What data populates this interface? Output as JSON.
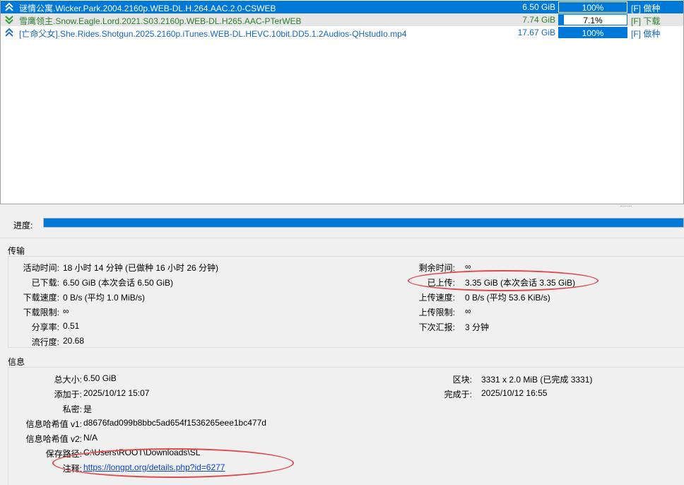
{
  "torrents": [
    {
      "name": "谜情公寓.Wicker.Park.2004.2160p.WEB-DL.H.264.AAC.2.0-CSWEB",
      "size": "6.50 GiB",
      "progress": "100%",
      "progress_value": 1.0,
      "status": "[F] 做种",
      "icon": "seed-up-icon"
    },
    {
      "name": "雪鹰领主.Snow.Eagle.Lord.2021.S03.2160p.WEB-DL.H265.AAC-PTerWEB",
      "size": "7.74 GiB",
      "progress": "7.1%",
      "progress_value": 0.071,
      "status": "[F] 下载",
      "icon": "download-down-icon"
    },
    {
      "name": "[亡命父女].She.Rides.Shotgun.2025.2160p.iTunes.WEB-DL.HEVC.10bit.DD5.1.2Audios-QHstudIo.mp4",
      "size": "17.67 GiB",
      "progress": "100%",
      "progress_value": 1.0,
      "status": "[F] 做种",
      "icon": "seed-up-icon"
    }
  ],
  "progress": {
    "label": "进度:",
    "value": 1.0
  },
  "transfer": {
    "title": "传输",
    "active_time_label": "活动时间:",
    "active_time": "18 小时 14 分钟 (已做种 16 小时 26 分钟)",
    "downloaded_label": "已下载:",
    "downloaded": "6.50 GiB (本次会话 6.50 GiB)",
    "dl_speed_label": "下载速度:",
    "dl_speed": "0 B/s (平均 1.0 MiB/s)",
    "dl_limit_label": "下载限制:",
    "dl_limit": "∞",
    "ratio_label": "分享率:",
    "ratio": "0.51",
    "popularity_label": "流行度:",
    "popularity": "20.68",
    "eta_label": "剩余时间:",
    "eta": "∞",
    "uploaded_label": "已上传:",
    "uploaded": "3.35 GiB (本次会话 3.35 GiB)",
    "ul_speed_label": "上传速度:",
    "ul_speed": "0 B/s (平均 53.6 KiB/s)",
    "ul_limit_label": "上传限制:",
    "ul_limit": "∞",
    "reannounce_label": "下次汇报:",
    "reannounce": "3 分钟"
  },
  "info": {
    "title": "信息",
    "total_size_label": "总大小:",
    "total_size": "6.50 GiB",
    "added_on_label": "添加于:",
    "added_on": "2025/10/12 15:07",
    "private_label": "私密:",
    "private": "是",
    "hash_v1_label": "信息哈希值 v1:",
    "hash_v1": "d8676fad099b8bbc5ad654f1536265eee1bc477d",
    "hash_v2_label": "信息哈希值 v2:",
    "hash_v2": "N/A",
    "save_path_label": "保存路径:",
    "save_path": "C:\\Users\\ROOT\\Downloads\\SL",
    "comment_label": "注释:",
    "comment": "https://longpt.org/details.php?id=6277",
    "pieces_label": "区块:",
    "pieces": "3331 x 2.0 MiB (已完成 3331)",
    "completed_on_label": "完成于:",
    "completed_on": "2025/10/12 16:55"
  },
  "colors": {
    "accent": "#0078d7",
    "seeding_text": "#1565c0",
    "downloading_text": "#2e7d32",
    "annotation": "#e04a4a"
  }
}
